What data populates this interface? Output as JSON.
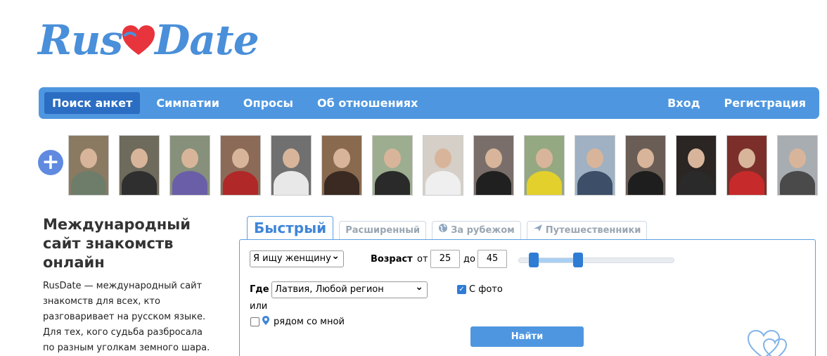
{
  "logo": {
    "part1": "Rus",
    "part2": "Date"
  },
  "nav": {
    "left": [
      "Поиск анкет",
      "Симпатии",
      "Опросы",
      "Об отношениях"
    ],
    "right": [
      "Вход",
      "Регистрация"
    ]
  },
  "photos": {
    "add_label": "+",
    "items": [
      {
        "bg": "#8a7a62",
        "shirt": "#6d7d6a"
      },
      {
        "bg": "#6e6a5c",
        "shirt": "#2f2f2f"
      },
      {
        "bg": "#86907a",
        "shirt": "#6a5ea8"
      },
      {
        "bg": "#8b6b57",
        "shirt": "#b02828"
      },
      {
        "bg": "#707070",
        "shirt": "#e8e8e8"
      },
      {
        "bg": "#8a6a4f",
        "shirt": "#3b2a22"
      },
      {
        "bg": "#9cae8f",
        "shirt": "#2a2a2a"
      },
      {
        "bg": "#d5cfc7",
        "shirt": "#efefef"
      },
      {
        "bg": "#7a6e6a",
        "shirt": "#202020"
      },
      {
        "bg": "#94a882",
        "shirt": "#e3d02c"
      },
      {
        "bg": "#9fb1c2",
        "shirt": "#3c4e68"
      },
      {
        "bg": "#6a5d55",
        "shirt": "#1e1e1e"
      },
      {
        "bg": "#2b2524",
        "shirt": "#2a2a2a"
      },
      {
        "bg": "#7c2f2a",
        "shirt": "#c72a2a"
      },
      {
        "bg": "#a8adb2",
        "shirt": "#4a4a4a"
      }
    ]
  },
  "intro": {
    "title": "Международный сайт знакомств онлайн",
    "text": "RusDate — международный сайт знакомств для всех, кто разговаривает на русском языке. Для тех, кого судьба разбросала по разным уголкам земного шара."
  },
  "search": {
    "tabs": [
      {
        "label": "Быстрый",
        "icon": ""
      },
      {
        "label": "Расширенный",
        "icon": ""
      },
      {
        "label": "За рубежом",
        "icon": "globe-icon"
      },
      {
        "label": "Путешественники",
        "icon": "plane-icon"
      }
    ],
    "seeking_value": "Я ищу женщину",
    "age_label": "Возраст",
    "from_label": "от",
    "from_value": "25",
    "to_label": "до",
    "to_value": "45",
    "age_min_value": 25,
    "age_max_value": 45,
    "where_label": "Где",
    "where_value": "Латвия, Любой регион",
    "with_photo_label": "С фото",
    "with_photo_checked": true,
    "or_label": "или",
    "nearby_label": "рядом со мной",
    "nearby_checked": false,
    "submit_label": "Найти"
  },
  "colors": {
    "brand_blue": "#4e97e0",
    "active_nav": "#2b6dc2",
    "heart_red": "#e8343c"
  }
}
